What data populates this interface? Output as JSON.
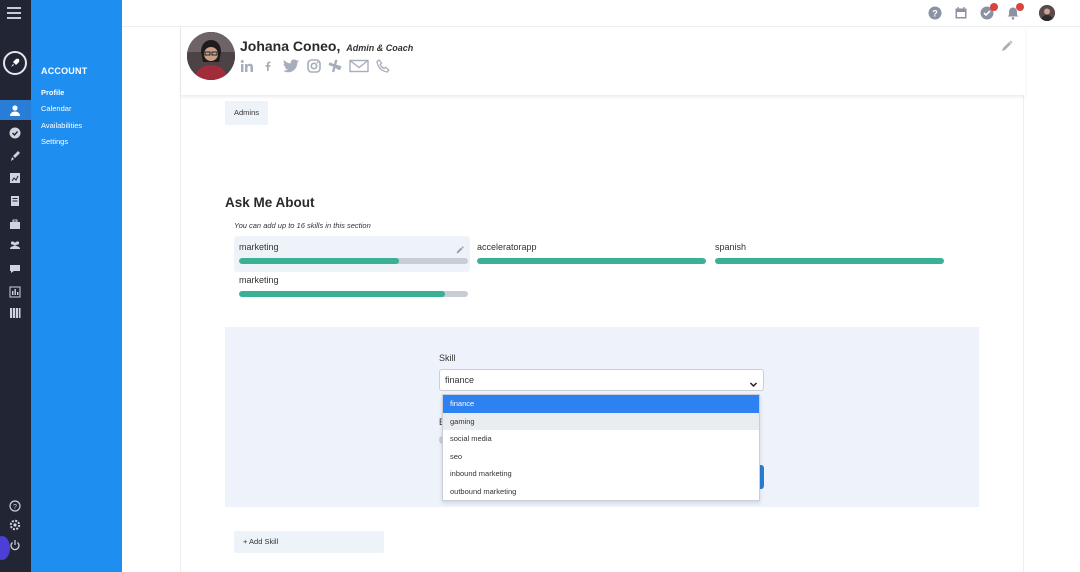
{
  "sidebar": {
    "section_title": "ACCOUNT",
    "items": [
      {
        "label": "Profile",
        "active": true
      },
      {
        "label": "Calendar",
        "active": false
      },
      {
        "label": "Availabilities",
        "active": false
      },
      {
        "label": "Settings",
        "active": false
      }
    ]
  },
  "rail_icons": [
    "menu-icon",
    "rocket-logo-icon",
    "user-icon",
    "check-circle-icon",
    "rocket-icon",
    "chart-icon",
    "document-icon",
    "briefcase-icon",
    "group-icon",
    "chat-icon",
    "analytics-icon",
    "library-icon",
    "help-icon",
    "gear-icon",
    "power-icon"
  ],
  "topbar": {
    "icons": [
      "help-icon",
      "calendar-icon",
      "tasks-icon",
      "bell-icon",
      "user-avatar"
    ],
    "badges": {
      "tasks": "",
      "notifications": ""
    }
  },
  "profile": {
    "name": "Johana Coneo,",
    "role": "Admin & Coach",
    "socials": [
      "linkedin-icon",
      "facebook-icon",
      "twitter-icon",
      "instagram-icon",
      "slack-icon",
      "email-icon",
      "phone-icon"
    ],
    "tags": [
      "Admins"
    ]
  },
  "ask_me_about": {
    "title": "Ask Me About",
    "hint": "You can add up to 16 skills in this section",
    "skills": [
      {
        "name": "marketing",
        "level": 0.7
      },
      {
        "name": "acceleratorapp",
        "level": 1.0
      },
      {
        "name": "spanish",
        "level": 1.0
      },
      {
        "name": "marketing",
        "level": 0.9
      }
    ],
    "add_skill_label": "+ Add Skill"
  },
  "skill_form": {
    "skill_label": "Skill",
    "selected_value": "finance",
    "hidden_label": "E",
    "options": [
      "finance",
      "gaming",
      "social media",
      "seo",
      "inbound marketing",
      "outbound marketing"
    ],
    "highlighted_option": "finance",
    "hovered_option": "gaming"
  },
  "colors": {
    "rail": "#212534",
    "sidebar": "#1e8ef1",
    "progress_fill": "#3ab094",
    "progress_track": "#c7ccd5",
    "panel_bg": "#eef3fb",
    "dropdown_active": "#2d81f0"
  }
}
